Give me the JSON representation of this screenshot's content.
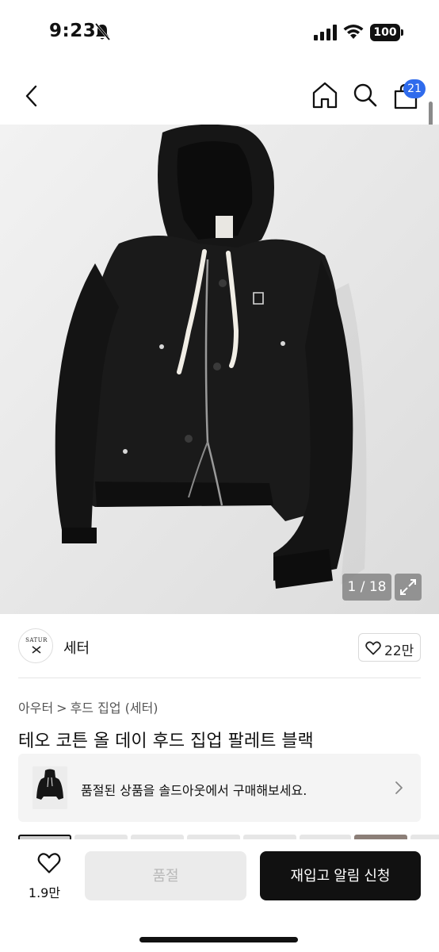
{
  "status_bar": {
    "time": "9:23",
    "battery": "100"
  },
  "nav": {
    "cart_count": "21",
    "icons": [
      "back-icon",
      "home-icon",
      "search-icon",
      "shopping-bag-icon"
    ]
  },
  "gallery": {
    "counter": "1 / 18"
  },
  "brand": {
    "logo_text": "SATUR",
    "name": "세터",
    "likes": "22만"
  },
  "breadcrumb": {
    "category": "아우터",
    "separator": ">",
    "subcategory": "후드 집업 (세터)"
  },
  "product": {
    "title": "테오 코튼 올 데이 후드 집업 팔레트 블랙"
  },
  "soldout_banner": {
    "text": "품절된 상품을 솔드아웃에서 구매해보세요."
  },
  "bottom_bar": {
    "wish_count": "1.9만",
    "soldout_label": "품절",
    "restock_label": "재입고 알림 신청"
  },
  "colors": {
    "accent_blue": "#2f6bec",
    "primary_button": "#111111",
    "disabled_button": "#ebebeb"
  }
}
